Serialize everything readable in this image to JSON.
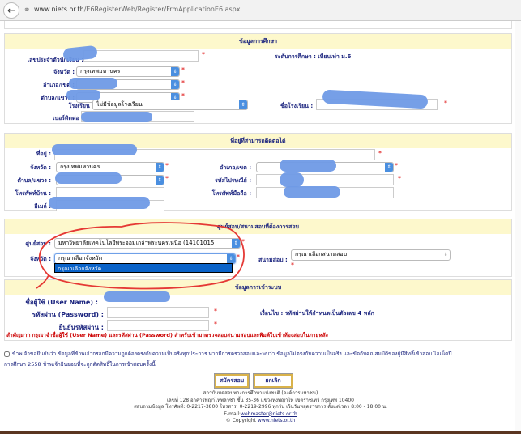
{
  "browser": {
    "url_host": "www.niets.or.th",
    "url_path": "/E6RegisterWeb/Register/FrmApplicationE6.aspx"
  },
  "education": {
    "title": "ข้อมูลการศึกษา",
    "student_id_label": "เลขประจำตัวนักเรียน :",
    "level_label": "ระดับการศึกษา : เทียบเท่า ม.6",
    "province_label": "จังหวัด :",
    "province_value": "กรุงเทพมหานคร",
    "district_label": "อำเภอ/เขต :",
    "subdistrict_label": "ตำบล/แขวง :",
    "school_label": "โรงเรียน :",
    "school_value": "ไม่มีข้อมูลโรงเรียน",
    "school_name_label": "ชื่อโรงเรียน :",
    "phone_label": "เบอร์ติดต่อ :"
  },
  "address": {
    "title": "ที่อยู่ที่สามารถติดต่อได้",
    "address_label": "ที่อยู่ :",
    "province_label": "จังหวัด :",
    "province_value": "กรุงเทพมหานคร",
    "district_label": "อำเภอ/เขต :",
    "subdistrict_label": "ตำบล/แขวง :",
    "postcode_label": "รหัสไปรษณีย์ :",
    "home_phone_label": "โทรศัพท์บ้าน :",
    "mobile_label": "โทรศัพท์มือถือ :",
    "email_label": "อีเมล์ :"
  },
  "exam": {
    "title": "ศูนย์สอบ/สนามสอบที่ต้องการสอบ",
    "center_label": "ศูนย์สอบ :",
    "center_value": "มหาวิทยาลัยเทคโนโลยีพระจอมเกล้าพระนครเหนือ (14101015",
    "province_label": "จังหวัด :",
    "province_value": "กรุณาเลือกจังหวัด",
    "field_label": "สนามสอบ :",
    "field_value": "กรุณาเลือกสนามสอบ",
    "dropdown_option": "กรุณาเลือกจังหวัด"
  },
  "login": {
    "title": "ข้อมูลการเข้าระบบ",
    "username_label": "ชื่อผู้ใช้ (User Name) :",
    "password_label": "รหัสผ่าน (Password) :",
    "confirm_label": "ยืนยันรหัสผ่าน :",
    "condition": "เงื่อนไข : รหัสผ่านให้กำหนดเป็นตัวเลข 4 หลัก",
    "important_prefix": "สำคัญมาก",
    "important_text": " กรุณาจำชื่อผู้ใช้ (User Name) และรหัสผ่าน (Password) สำหรับเข้ามาตรวจสอบสนามสอบและพิมพ์ใบเข้าห้องสอบในภายหลัง"
  },
  "consent": {
    "line1": "ข้าพเจ้าขอยืนยันว่า ข้อมูลที่ข้าพเจ้ากรอกมีความถูกต้องตรงกับความเป็นจริงทุกประการ หากมีการตรวจสอบและพบว่า ข้อมูลไม่ตรงกับความเป็นจริง และขัดกับคุณสมบัติของผู้มีสิทธิ์เข้าสอบ ไอเน็ตปี",
    "line2": "การศึกษา 2558 ข้าพเจ้ายินยอมที่จะถูกตัดสิทธิ์ในการเข้าสอบครั้งนี้"
  },
  "buttons": {
    "submit": "สมัครสอบ",
    "cancel": "ยกเลิก"
  },
  "footer": {
    "org": "สถาบันทดสอบทางการศึกษาแห่งชาติ (องค์การมหาชน)",
    "address": "เลขที่ 128 อาคารพญาไทพลาซ่า ชั้น 35-36 แขวงทุ่งพญาไท เขตราชเทวี กรุงเทพ 10400",
    "contact": "สอบถามข้อมูล โทรศัพท์: 0-2217-3800 โทรสาร: 0-2219-2996 ทุกวัน เว้นวันหยุดราชการ ตั้งแต่เวลา 8:00 - 18:00 น.",
    "email_prefix": "E-mail:",
    "email": "webmaster@niets.or.th",
    "copyright_prefix": "© Copyright ",
    "site": "www.niets.or.th"
  }
}
